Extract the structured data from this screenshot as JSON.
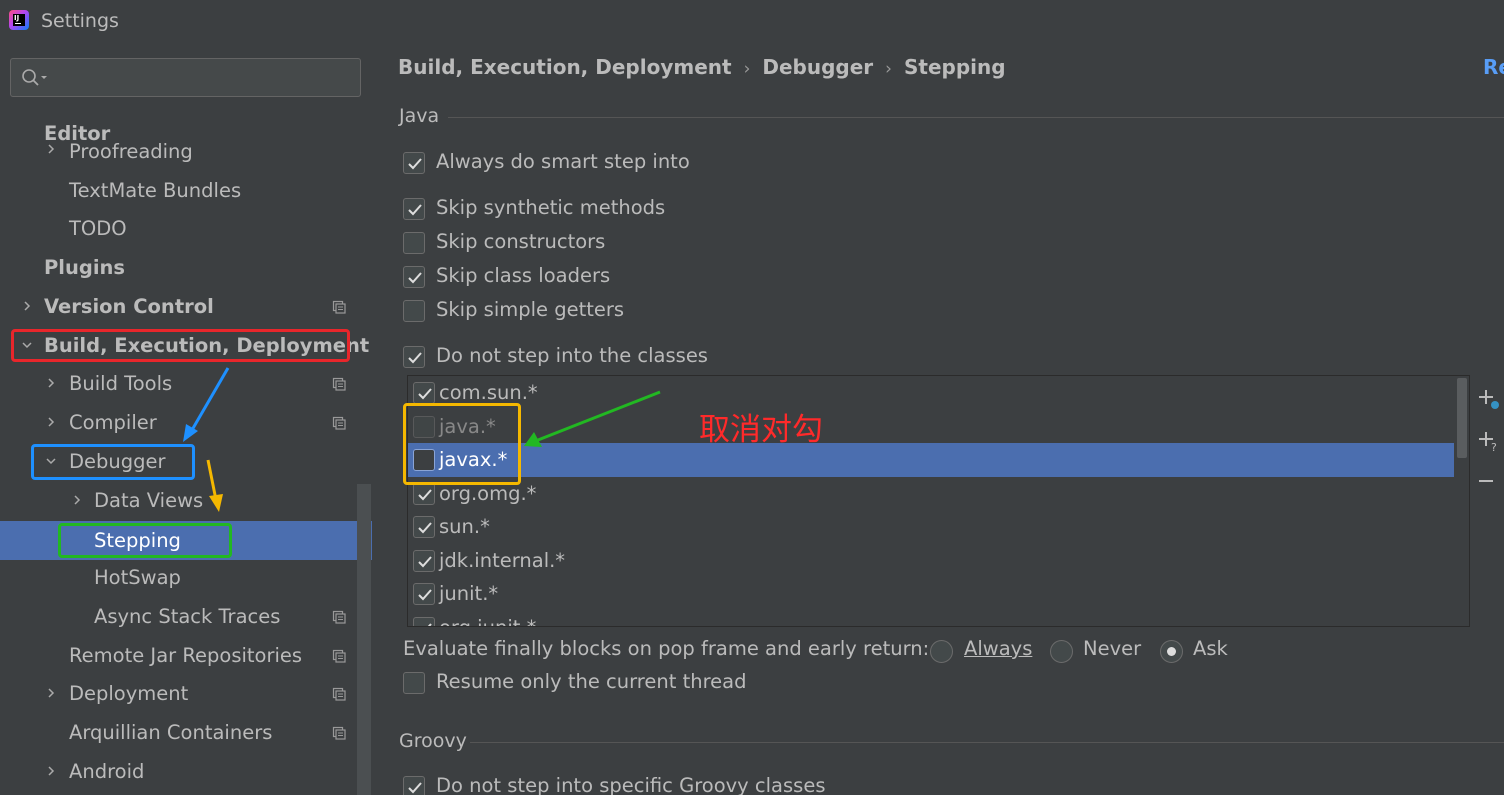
{
  "window": {
    "title": "Settings"
  },
  "search": {
    "placeholder": ""
  },
  "sidebar": {
    "items": [
      {
        "label": "Editor",
        "bold": true
      },
      {
        "label": "Proofreading",
        "expandable": true
      },
      {
        "label": "TextMate Bundles"
      },
      {
        "label": "TODO"
      },
      {
        "label": "Plugins",
        "bold": true
      },
      {
        "label": "Version Control",
        "bold": true,
        "expandable": true
      },
      {
        "label": "Build, Execution, Deployment",
        "bold": true,
        "expanded": true
      },
      {
        "label": "Build Tools",
        "expandable": true
      },
      {
        "label": "Compiler",
        "expandable": true
      },
      {
        "label": "Debugger",
        "expanded": true
      },
      {
        "label": "Data Views",
        "expandable": true
      },
      {
        "label": "Stepping",
        "selected": true
      },
      {
        "label": "HotSwap"
      },
      {
        "label": "Async Stack Traces"
      },
      {
        "label": "Remote Jar Repositories"
      },
      {
        "label": "Deployment",
        "expandable": true
      },
      {
        "label": "Arquillian Containers"
      },
      {
        "label": "Android",
        "expandable": true
      }
    ]
  },
  "breadcrumb": {
    "items": [
      "Build, Execution, Deployment",
      "Debugger",
      "Stepping"
    ],
    "separator": "›",
    "reset_label": "Re"
  },
  "java": {
    "title": "Java",
    "options": [
      {
        "label": "Always do smart step into",
        "checked": true
      },
      {
        "label": "Skip synthetic methods",
        "checked": true
      },
      {
        "label": "Skip constructors",
        "checked": false
      },
      {
        "label": "Skip class loaders",
        "checked": true
      },
      {
        "label": "Skip simple getters",
        "checked": false
      },
      {
        "label": "Do not step into the classes",
        "checked": true
      }
    ],
    "classes": [
      {
        "label": "com.sun.*",
        "checked": true
      },
      {
        "label": "java.*",
        "checked": false,
        "disabled": true
      },
      {
        "label": "javax.*",
        "checked": false,
        "selected": true
      },
      {
        "label": "org.omg.*",
        "checked": true
      },
      {
        "label": "sun.*",
        "checked": true
      },
      {
        "label": "jdk.internal.*",
        "checked": true
      },
      {
        "label": "junit.*",
        "checked": true
      },
      {
        "label": "org.junit.*",
        "checked": true
      }
    ],
    "evaluate_finally": {
      "label": "Evaluate finally blocks on pop frame and early return:",
      "options": [
        "Always",
        "Never",
        "Ask"
      ],
      "selected": "Ask"
    },
    "resume_only": {
      "label": "Resume only the current thread",
      "checked": false
    }
  },
  "groovy": {
    "title": "Groovy",
    "options": [
      {
        "label": "Do not step into specific Groovy classes",
        "checked": true
      }
    ]
  },
  "toolbar": {
    "add_class_icon": "add-class-icon",
    "add_pattern_icon": "add-pattern-icon",
    "remove_icon": "remove-icon"
  },
  "annotation": {
    "text": "取消对勾",
    "colors": {
      "red": "#e8262b",
      "blue": "#1e90ff",
      "yellow": "#f5b800",
      "green": "#22b822"
    }
  },
  "colors": {
    "accent": "#4b6eaf",
    "link": "#589df6",
    "background": "#3c3f41"
  }
}
